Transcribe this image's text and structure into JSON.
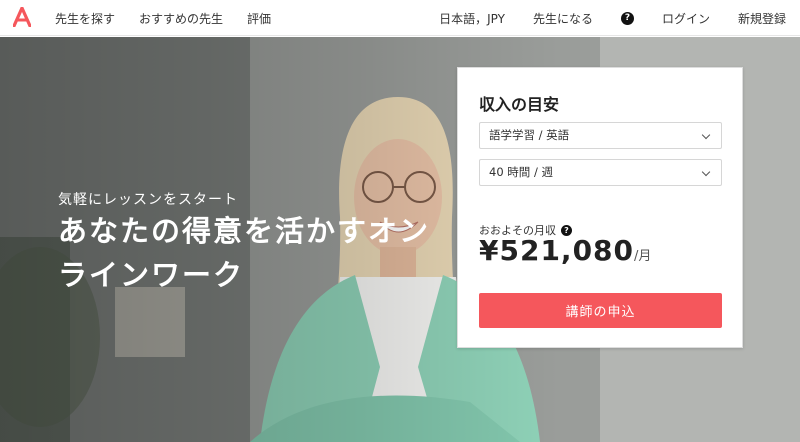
{
  "nav": {
    "logo_letter": "A",
    "find_teacher": "先生を探す",
    "recommended_teachers": "おすすめの先生",
    "reviews": "評価",
    "language_currency": "日本語，JPY",
    "become_teacher": "先生になる",
    "help_icon": "?",
    "login": "ログイン",
    "signup": "新規登録"
  },
  "hero": {
    "subtitle": "気軽にレッスンをスタート",
    "title": "あなたの得意を活かすオンラインワーク"
  },
  "estimator": {
    "title": "収入の目安",
    "subject_select": "語学学習 / 英語",
    "hours_select": "40 時間 / 週",
    "estimate_label": "おおよその月収",
    "estimate_help_icon": "?",
    "amount": "¥521,080",
    "amount_unit": "/月",
    "apply_button": "講師の申込"
  },
  "colors": {
    "brand_red": "#f5575c",
    "card_bg": "#ffffff"
  }
}
